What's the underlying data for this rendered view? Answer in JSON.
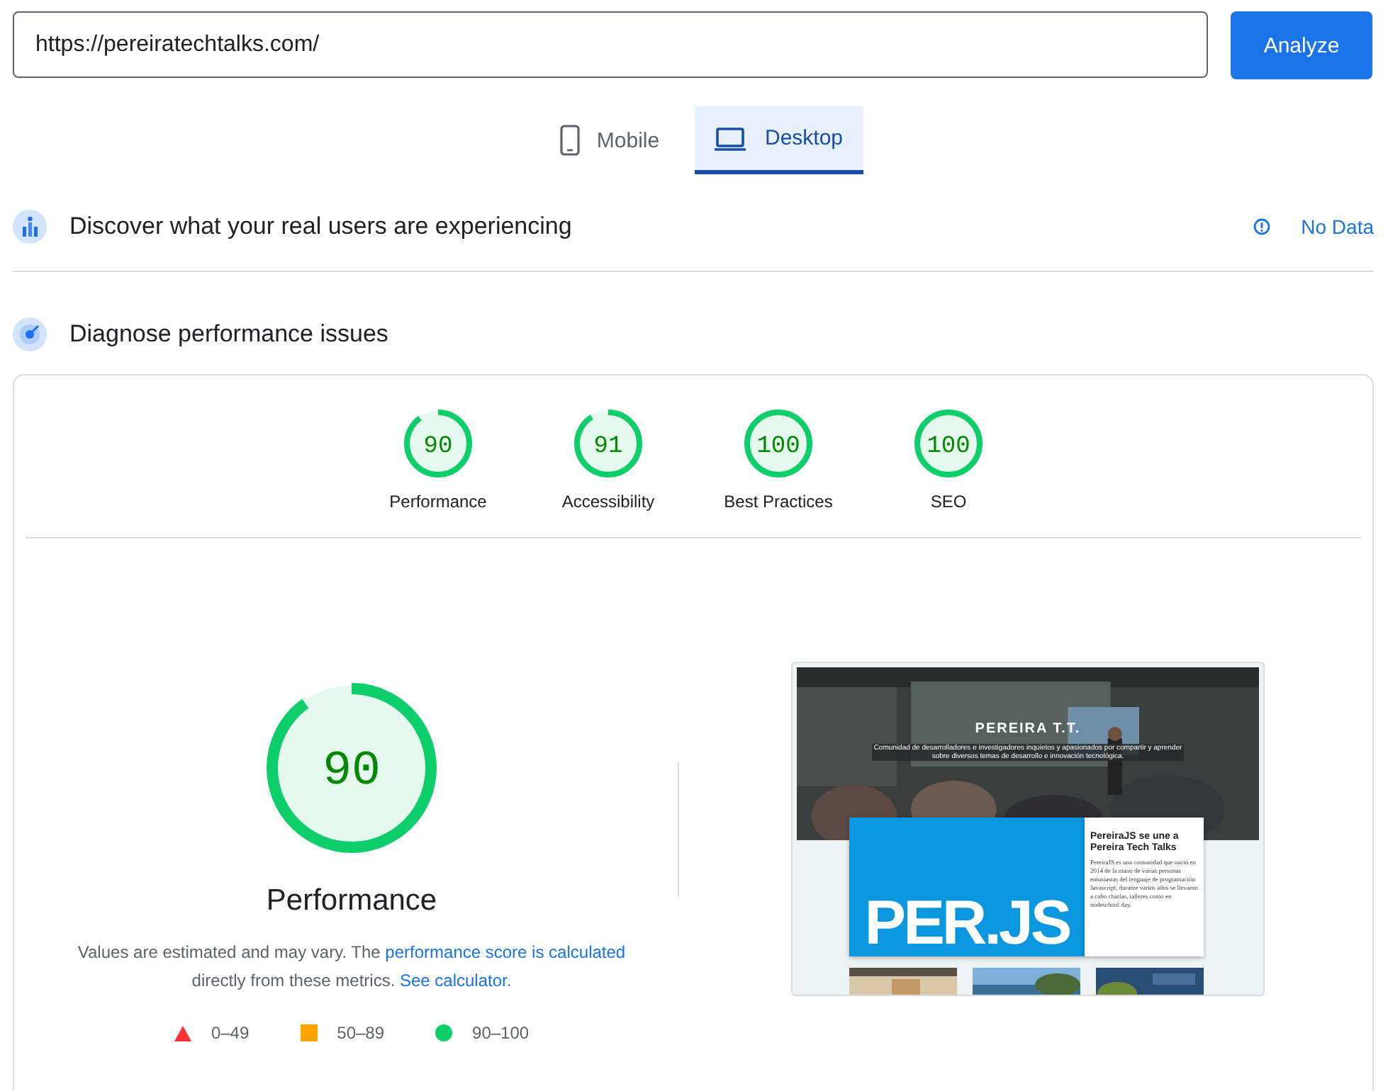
{
  "url_field": {
    "value": "https://pereiratechtalks.com/"
  },
  "analyze_button": {
    "label": "Analyze"
  },
  "tabs": [
    {
      "label": "Mobile",
      "kind": "phone",
      "selected": false
    },
    {
      "label": "Desktop",
      "kind": "laptop",
      "selected": true
    }
  ],
  "field_data": {
    "title": "Discover what your real users are experiencing",
    "status": "No Data"
  },
  "lab_data": {
    "title": "Diagnose performance issues"
  },
  "categories": [
    {
      "score": "90",
      "label": "Performance",
      "level": 0.9
    },
    {
      "score": "91",
      "label": "Accessibility",
      "level": 0.91
    },
    {
      "score": "100",
      "label": "Best Practices",
      "level": 1
    },
    {
      "score": "100",
      "label": "SEO",
      "level": 1
    }
  ],
  "main_gauge": {
    "score": "90",
    "label": "Performance",
    "level": 0.9
  },
  "note": {
    "text_before": "Values are estimated and may vary. The",
    "link1": "performance score is calculated",
    "text_middle": "directly from these metrics.",
    "link2": "See calculator."
  },
  "legend": [
    {
      "kind": "triangle",
      "label": "0–49",
      "color": "#ff3333"
    },
    {
      "kind": "square",
      "label": "50–89",
      "color": "#ffa400"
    },
    {
      "kind": "circle",
      "label": "90–100",
      "color": "#0cce6b"
    }
  ],
  "screenshot": {
    "logo": "PEREIRA T.T.",
    "tagline": "Comunidad de desarrolladores e investigadores inquietos y apasionados por compartir y aprender sobre diversos temas de desarrollo e innovación tecnológica.",
    "hero": "PER.JS",
    "article_title": "PereiraJS se une a Pereira Tech Talks",
    "article_text": "PereiraJS es una comunidad que nació en 2014 de la mano de varias personas entusiastas del lenguaje de programación Javascript, durante varios años se llevaron a cabo charlas, talleres como en nodeschool day."
  }
}
